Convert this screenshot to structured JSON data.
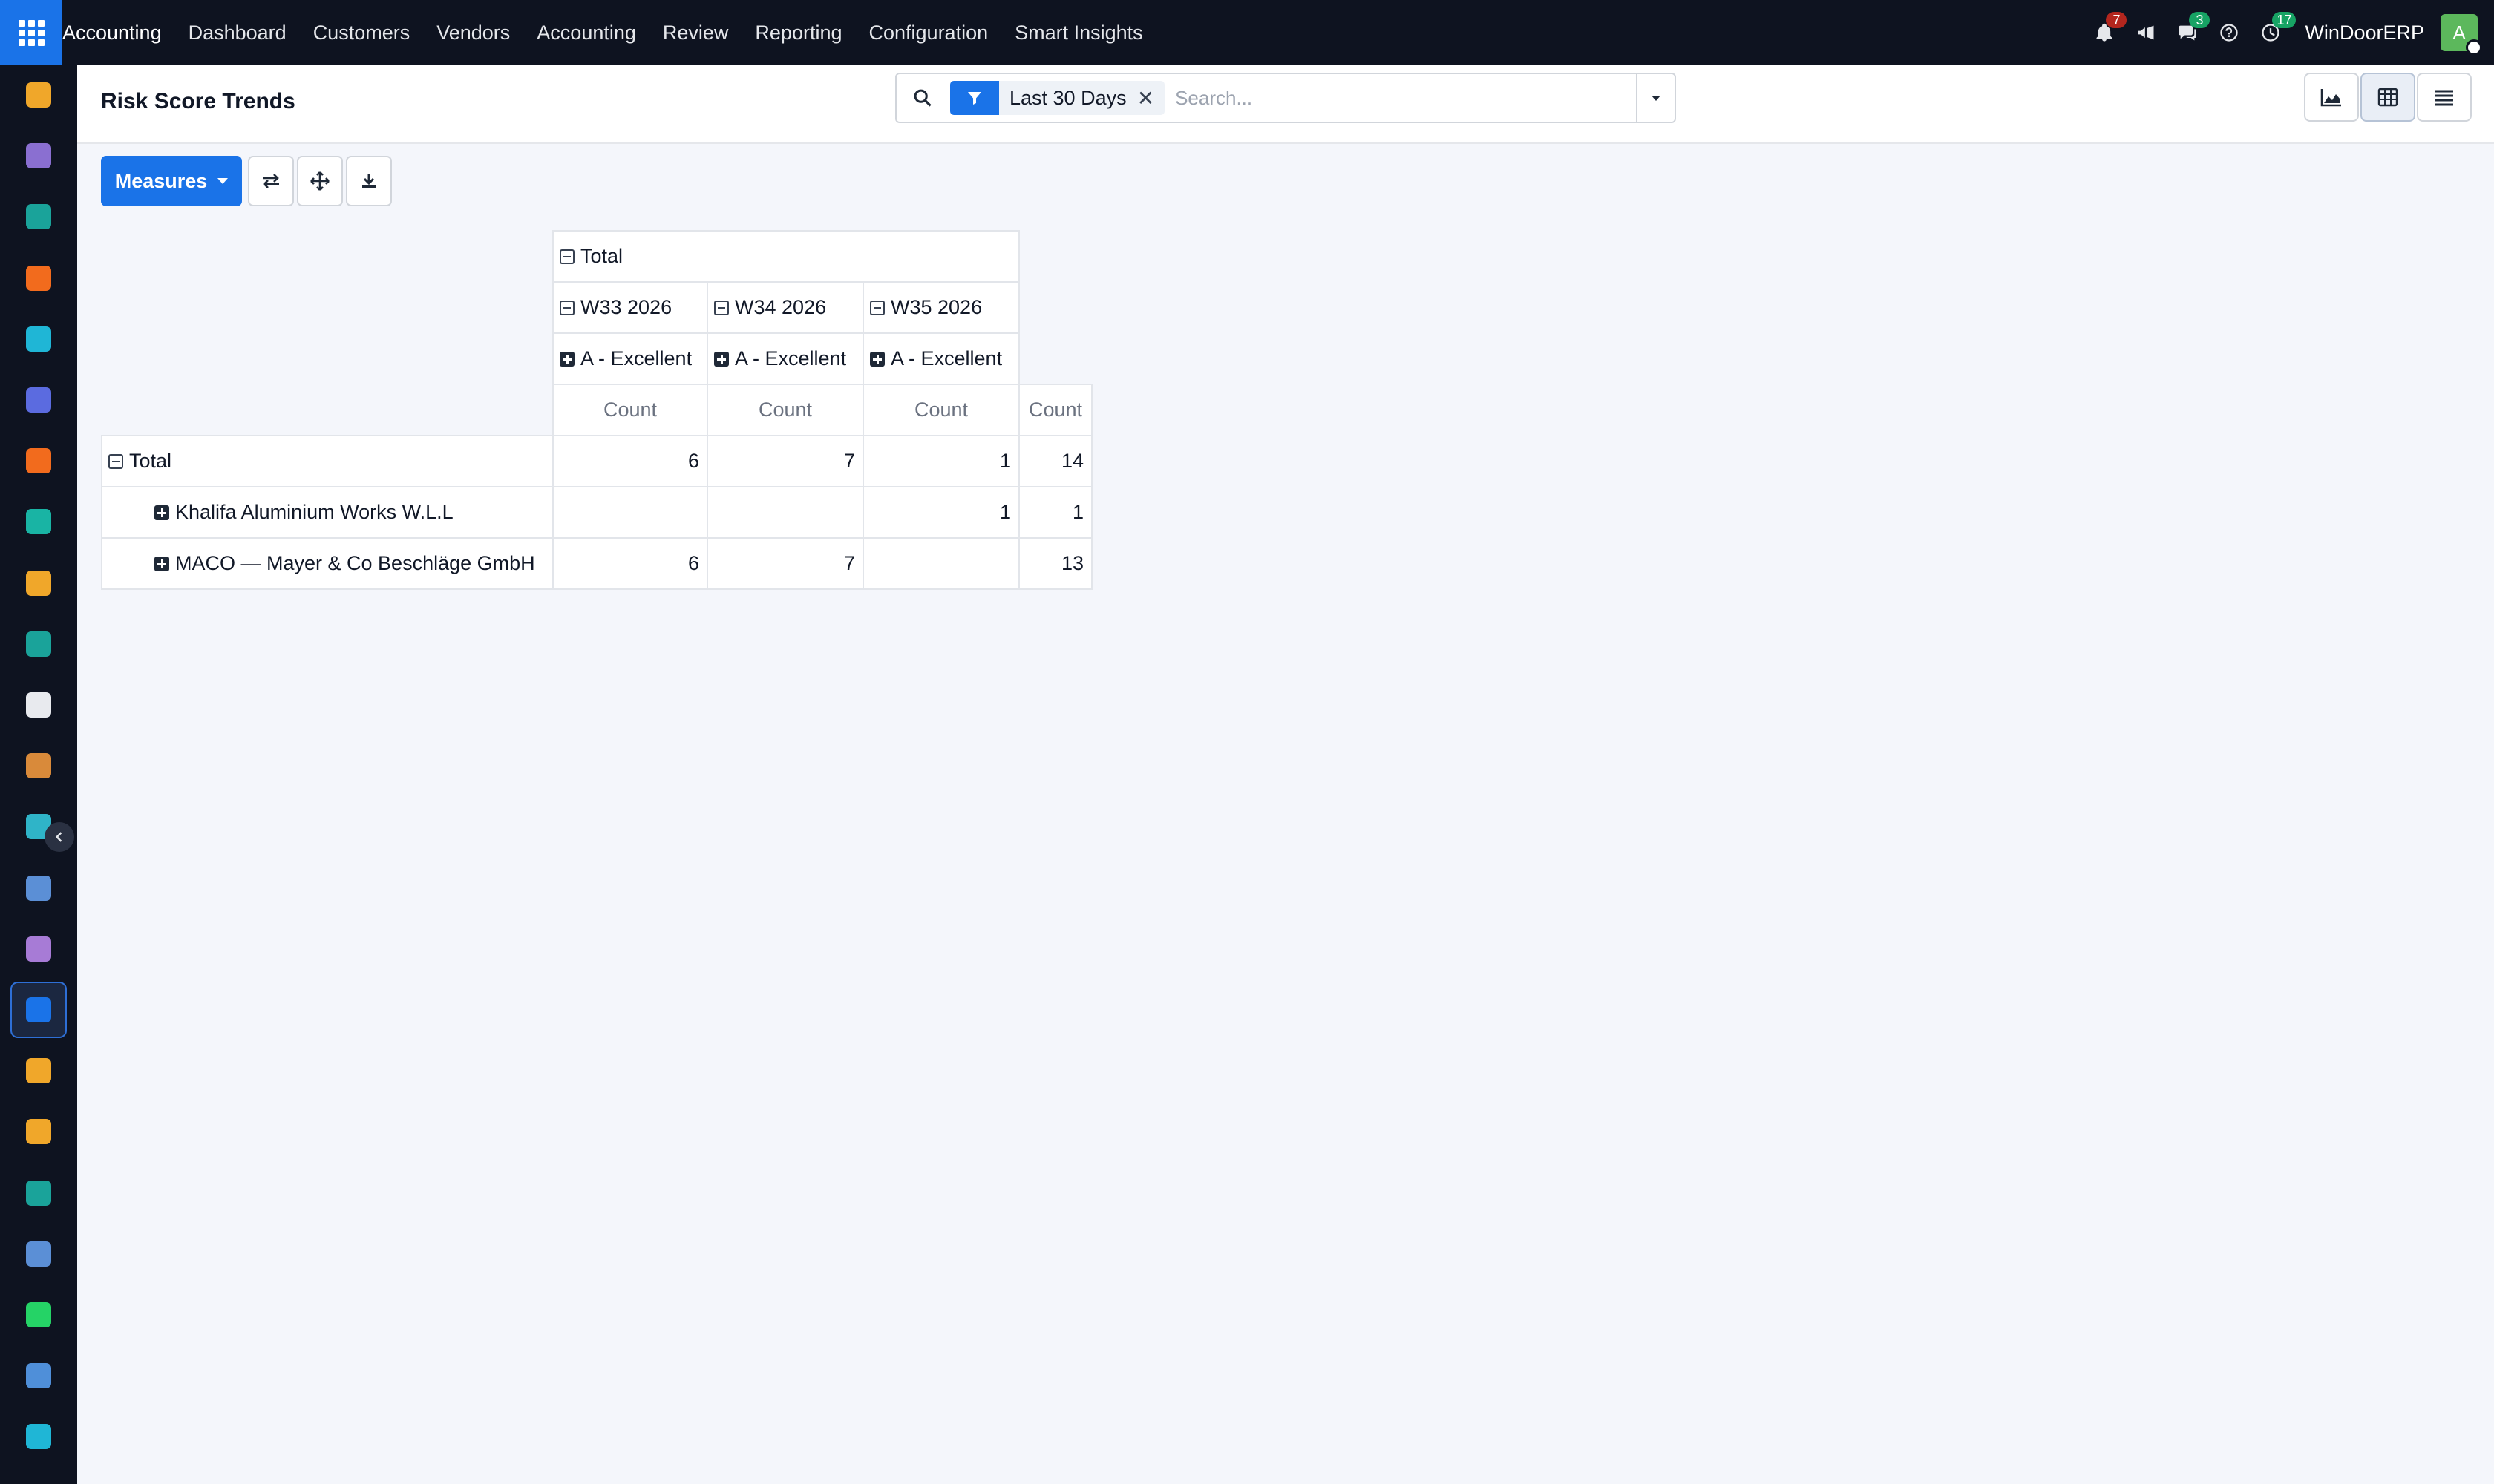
{
  "topbar": {
    "brand": "Accounting",
    "menu": [
      "Dashboard",
      "Customers",
      "Vendors",
      "Accounting",
      "Review",
      "Reporting",
      "Configuration",
      "Smart Insights"
    ],
    "notifications_count": "7",
    "messages_count": "3",
    "activities_count": "17",
    "company": "WinDoorERP",
    "user_initial": "A"
  },
  "sidebar": {
    "apps": [
      {
        "icon": "invoicing-icon",
        "color": "#f0a72a"
      },
      {
        "icon": "discuss-icon",
        "color": "#8a6fd1"
      },
      {
        "icon": "contacts-icon",
        "color": "#1aa39a"
      },
      {
        "icon": "chat-bubble-icon",
        "color": "#f26b1d"
      },
      {
        "icon": "website-icon",
        "color": "#1fb6d6"
      },
      {
        "icon": "email-marketing-icon",
        "color": "#5b6be0"
      },
      {
        "icon": "livechat-icon",
        "color": "#f26b1d"
      },
      {
        "icon": "crm-icon",
        "color": "#19b4a4"
      },
      {
        "icon": "sales-icon",
        "color": "#f0a72a"
      },
      {
        "icon": "employees-icon",
        "color": "#1aa39a"
      },
      {
        "icon": "inventory-icon",
        "color": "#e8eaee"
      },
      {
        "icon": "documents-icon",
        "color": "#d98a3a"
      },
      {
        "icon": "project-icon",
        "color": "#2fb4c8"
      },
      {
        "icon": "knowledge-icon",
        "color": "#5b8fd6"
      },
      {
        "icon": "products-icon",
        "color": "#a77bd6"
      },
      {
        "icon": "accounting-icon",
        "color": "#1a73e8"
      },
      {
        "icon": "team-icon",
        "color": "#f0a72a"
      },
      {
        "icon": "calendar-icon",
        "color": "#f0a72a"
      },
      {
        "icon": "sign-icon",
        "color": "#1aa39a"
      },
      {
        "icon": "dashboards-icon",
        "color": "#5b8fd6"
      },
      {
        "icon": "whatsapp-icon",
        "color": "#25d366"
      },
      {
        "icon": "timesheet-icon",
        "color": "#4f8fd9"
      },
      {
        "icon": "website-builder-icon",
        "color": "#1fb6d6"
      }
    ],
    "active_index": 15
  },
  "control_panel": {
    "title": "Risk Score Trends",
    "facet_value": "Last 30 Days",
    "search_placeholder": "Search..."
  },
  "toolbar": {
    "measures_label": "Measures"
  },
  "pivot": {
    "col_total_label": "Total",
    "week_headers": [
      "W33 2026",
      "W34 2026",
      "W35 2026"
    ],
    "grade_headers": [
      "A - Excellent",
      "A - Excellent",
      "A - Excellent"
    ],
    "measure_label": "Count",
    "rows": [
      {
        "label": "Total",
        "values": [
          "6",
          "7",
          "1",
          "14"
        ]
      },
      {
        "label": "Khalifa Aluminium Works W.L.L",
        "values": [
          "",
          "",
          "1",
          "1"
        ]
      },
      {
        "label": "MACO — Mayer & Co Beschläge GmbH",
        "values": [
          "6",
          "7",
          "",
          "13"
        ]
      }
    ]
  }
}
